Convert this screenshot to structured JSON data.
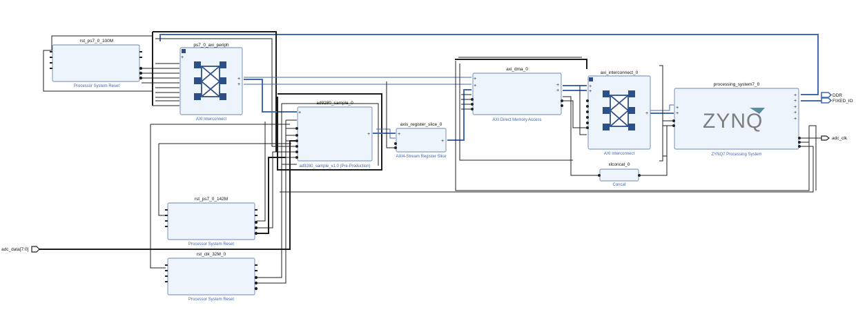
{
  "blocks": {
    "rst100": {
      "name": "rst_ps7_0_100M",
      "subtitle": "Processor System Reset"
    },
    "ps7_axi_periph": {
      "name": "ps7_0_axi_periph",
      "subtitle": "AXI Interconnect"
    },
    "ad9280": {
      "name": "ad9280_sample_0",
      "subtitle": "ad9280_sample_v1.0 (Pre-Production)"
    },
    "axis_slice": {
      "name": "axis_register_slice_0",
      "subtitle": "AXI4-Stream Register Slice"
    },
    "axi_dma": {
      "name": "axi_dma_0",
      "subtitle": "AXI Direct Memory Access"
    },
    "axi_interconnect": {
      "name": "axi_interconnect_0",
      "subtitle": "AXI Interconnect"
    },
    "ps7": {
      "name": "processing_system7_0",
      "subtitle": "ZYNQ7 Processing System",
      "logo": "ZYNQ"
    },
    "xlconcat": {
      "name": "xlconcat_0",
      "subtitle": "Concat"
    },
    "rst142": {
      "name": "rst_ps7_0_142M",
      "subtitle": "Processor System Reset"
    },
    "rst32": {
      "name": "rst_clk_32M_0",
      "subtitle": "Processor System Reset"
    }
  },
  "external_ports": {
    "ddr": "DDR",
    "fixed_io": "FIXED_IO",
    "adc_clk": "adc_clk",
    "adc_data": "adc_data[7:0]"
  },
  "colors": {
    "block_fill": "#edf4fc",
    "block_border": "#6b87b3",
    "bus": "#4169b0",
    "wire": "#1c1c1c",
    "subtitle": "#3f66b0",
    "crossbar": "#2c4f87"
  }
}
